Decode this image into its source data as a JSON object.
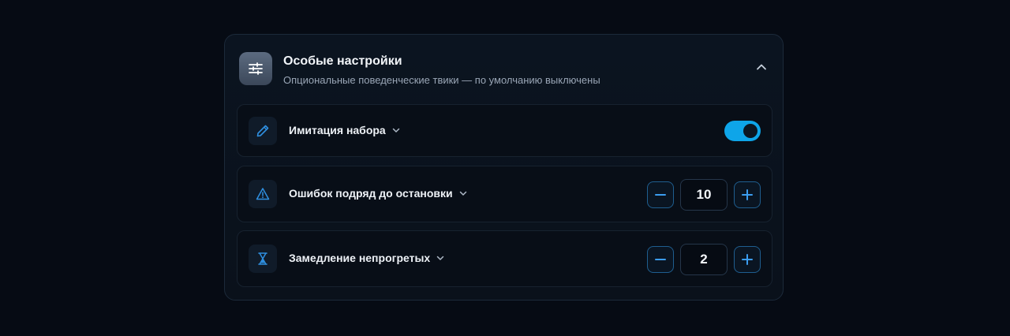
{
  "panel": {
    "title": "Особые настройки",
    "subtitle": "Опциональные поведенческие твики — по умолчанию выключены",
    "icon": "sliders-icon",
    "collapse_icon": "chevron-up-icon",
    "expanded": true
  },
  "settings": [
    {
      "label": "Имитация набора",
      "icon": "pencil-icon",
      "control": "toggle",
      "enabled": true
    },
    {
      "label": "Ошибок подряд до остановки",
      "icon": "warning-icon",
      "control": "stepper",
      "value": "10"
    },
    {
      "label": "Замедление непрогретых",
      "icon": "hourglass-icon",
      "control": "stepper",
      "value": "2"
    }
  ],
  "colors": {
    "accent": "#0ea5e9",
    "icon_blue": "#2f8fe0",
    "background": "#060b14",
    "panel": "#0b1420"
  }
}
